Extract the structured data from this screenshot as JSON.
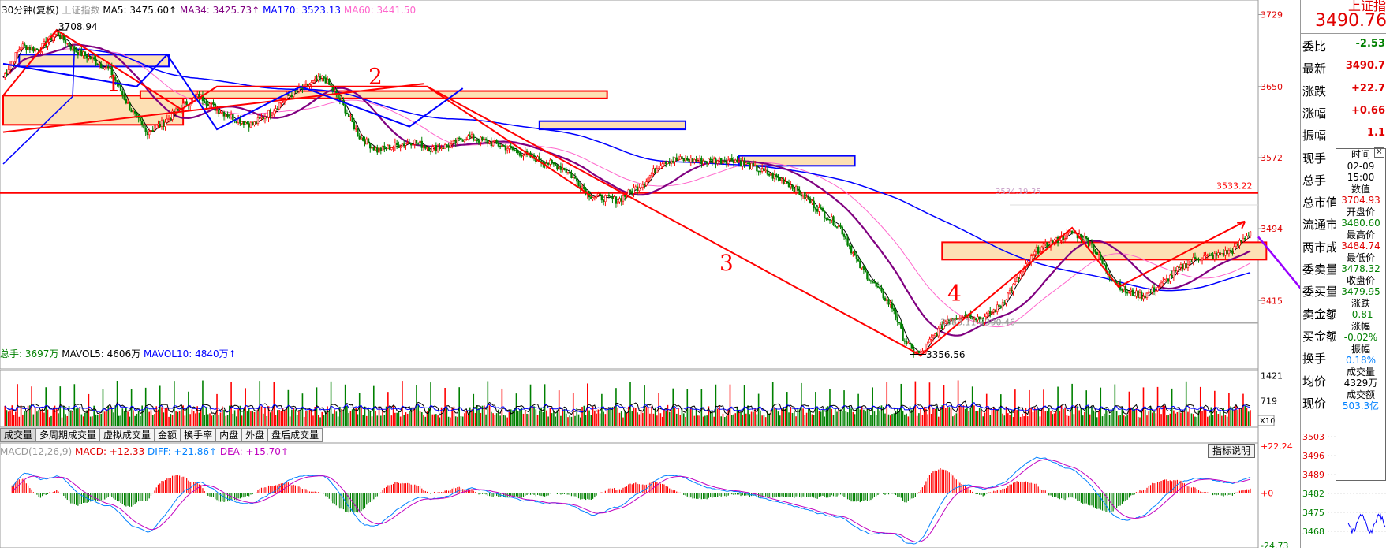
{
  "header": {
    "period": "30分钟(复权)",
    "index_name": "上证指数",
    "ma5": "MA5: 3475.60↑",
    "ma34": "MA34: 3425.73↑",
    "ma170": "MA170: 3523.13",
    "ma60": "MA60: 3441.50"
  },
  "colors": {
    "ma5": "#000000",
    "ma34": "#800080",
    "ma170": "#0000ff",
    "ma60": "#ff66cc",
    "up": "#ff0000",
    "down": "#008000",
    "pattern_red": "#ff0000",
    "pattern_blue": "#0000ff",
    "box_fill": "#fde0b4"
  },
  "chart_data": [
    {
      "type": "candlestick",
      "title": "上证指数 30分钟(复权)",
      "y_ticks": [
        "3729",
        "3650",
        "3572",
        "3494",
        "3415"
      ],
      "ylim": [
        3340,
        3745
      ],
      "reference_line": 3533.22,
      "reference_label": "3533.22",
      "gray_line": 3390.46,
      "annotations": [
        "3708.94",
        "3356.56",
        "3388.11-3390.46",
        "1",
        "2",
        "3",
        "4"
      ],
      "ma_lines": [
        "MA5",
        "MA34",
        "MA170",
        "MA60"
      ],
      "close_path": [
        [
          0,
          3660
        ],
        [
          10,
          3695
        ],
        [
          20,
          3690
        ],
        [
          30,
          3708.94
        ],
        [
          40,
          3690
        ],
        [
          50,
          3680
        ],
        [
          60,
          3668
        ],
        [
          70,
          3630
        ],
        [
          80,
          3600
        ],
        [
          90,
          3610
        ],
        [
          100,
          3628
        ],
        [
          110,
          3640
        ],
        [
          120,
          3625
        ],
        [
          130,
          3615
        ],
        [
          140,
          3608
        ],
        [
          150,
          3622
        ],
        [
          160,
          3640
        ],
        [
          170,
          3650
        ],
        [
          180,
          3660
        ],
        [
          190,
          3632
        ],
        [
          200,
          3595
        ],
        [
          210,
          3580
        ],
        [
          220,
          3585
        ],
        [
          230,
          3590
        ],
        [
          240,
          3582
        ],
        [
          250,
          3585
        ],
        [
          260,
          3595
        ],
        [
          280,
          3585
        ],
        [
          300,
          3570
        ],
        [
          315,
          3560
        ],
        [
          330,
          3530
        ],
        [
          345,
          3525
        ],
        [
          360,
          3545
        ],
        [
          370,
          3568
        ],
        [
          380,
          3570
        ],
        [
          395,
          3568
        ],
        [
          410,
          3570
        ],
        [
          420,
          3562
        ],
        [
          440,
          3545
        ],
        [
          455,
          3520
        ],
        [
          470,
          3495
        ],
        [
          480,
          3455
        ],
        [
          490,
          3430
        ],
        [
          500,
          3405
        ],
        [
          505,
          3375
        ],
        [
          510,
          3360
        ],
        [
          515,
          3356.56
        ],
        [
          520,
          3370
        ],
        [
          530,
          3395
        ],
        [
          540,
          3400
        ],
        [
          550,
          3395
        ],
        [
          560,
          3410
        ],
        [
          570,
          3440
        ],
        [
          580,
          3470
        ],
        [
          590,
          3480
        ],
        [
          600,
          3490
        ],
        [
          610,
          3480
        ],
        [
          620,
          3445
        ],
        [
          630,
          3425
        ],
        [
          640,
          3420
        ],
        [
          650,
          3432
        ],
        [
          660,
          3450
        ],
        [
          670,
          3462
        ],
        [
          680,
          3464
        ],
        [
          690,
          3470
        ],
        [
          700,
          3490.76
        ]
      ]
    },
    {
      "type": "bar",
      "title": "成交量",
      "legend": [
        "总手: 3697万",
        "MAVOL5: 4606万",
        "MAVOL10: 4840万↑"
      ],
      "y_ticks": [
        "1421",
        "719"
      ],
      "unit_label": "X10",
      "ylim": [
        0,
        1480
      ]
    },
    {
      "type": "bar",
      "title": "MACD",
      "legend": [
        "MACD(12,26,9)",
        "MACD: +12.33",
        "DIFF: +21.86↑",
        "DEA: +15.70↑"
      ],
      "y_ticks": [
        "+22.24",
        "+0",
        "-24.73"
      ],
      "ylim": [
        -24.73,
        22.24
      ]
    }
  ],
  "volume_legend": {
    "total": "总手: 3697万",
    "mavol5": "MAVOL5: 4606万",
    "mavol10": "MAVOL10: 4840万↑"
  },
  "volume_axis": {
    "top": "1421",
    "mid": "719",
    "unit": "X10"
  },
  "tabs": [
    "成交量",
    "多周期成交量",
    "虚拟成交量",
    "金额",
    "换手率",
    "内盘",
    "外盘",
    "盘后成交量"
  ],
  "macd_legend": {
    "name": "MACD(12,26,9)",
    "macd": "MACD: +12.33",
    "diff": "DIFF: +21.86↑",
    "dea": "DEA: +15.70↑"
  },
  "macd_axis": {
    "top": "+22.24",
    "mid": "+0",
    "bottom": "-24.73"
  },
  "explain_button": "指标说明",
  "price_axis": [
    "3729",
    "3650",
    "3572",
    "3494",
    "3415"
  ],
  "price_labels": {
    "high": "3708.94",
    "low": "3356.56",
    "ref": "3533.22",
    "gray": "3388.11-3390.46",
    "faint": "3534.19-35"
  },
  "pattern_numbers": [
    "1",
    "2",
    "3",
    "4"
  ],
  "right_panel": {
    "title": "上证指",
    "price": "3490.76",
    "rows": [
      {
        "label": "委比",
        "value": "-2.53"
      },
      {
        "label": "最新",
        "value": "3490.7"
      },
      {
        "label": "涨跌",
        "value": "+22.7"
      },
      {
        "label": "涨幅",
        "value": "+0.66"
      },
      {
        "label": "振幅",
        "value": "1.1"
      },
      {
        "label": "现手",
        "value": ""
      },
      {
        "label": "总手",
        "value": ""
      },
      {
        "label": "总市值",
        "value": ""
      },
      {
        "label": "流通市",
        "value": ""
      },
      {
        "label": "两市成",
        "value": ""
      },
      {
        "label": "委卖量",
        "value": ""
      },
      {
        "label": "委买量",
        "value": ""
      },
      {
        "label": "卖金额",
        "value": ""
      },
      {
        "label": "买金额",
        "value": ""
      },
      {
        "label": "换手",
        "value": ""
      },
      {
        "label": "均价",
        "value": ""
      },
      {
        "label": "现价",
        "value": ""
      }
    ],
    "mini_axis": [
      "3503",
      "3496",
      "3489",
      "3482",
      "3475",
      "3468"
    ]
  },
  "popup": {
    "time_label": "时间",
    "date": "02-09",
    "time": "15:00",
    "value_label": "数值",
    "value": "3704.93",
    "open_label": "开盘价",
    "open": "3480.60",
    "high_label": "最高价",
    "high": "3484.74",
    "low_label": "最低价",
    "low": "3478.32",
    "close_label": "收盘价",
    "close": "3479.95",
    "change_label": "涨跌",
    "change": "-0.81",
    "pct_label": "涨幅",
    "pct": "-0.02%",
    "amp_label": "振幅",
    "amp": "0.18%",
    "vol_label": "成交量",
    "vol": "4329万",
    "amt_label": "成交额",
    "amt": "503.3亿",
    "close_x": "×"
  }
}
